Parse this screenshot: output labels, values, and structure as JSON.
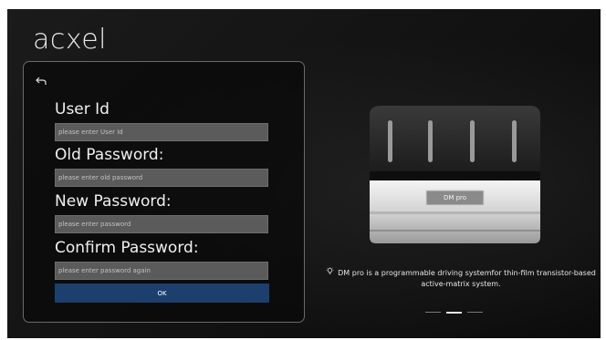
{
  "brand": {
    "name": "acxel"
  },
  "form": {
    "back_icon": "back-arrow-icon",
    "user_id_label": "User Id",
    "user_id_placeholder": "please enter User Id",
    "old_password_label": "Old Password:",
    "old_password_placeholder": "please enter old password",
    "new_password_label": "New Password:",
    "new_password_placeholder": "please enter password",
    "confirm_password_label": "Confirm Password:",
    "confirm_password_placeholder": "please enter password again",
    "ok_label": "OK",
    "ok_color": "#1c3f6e"
  },
  "product": {
    "badge": "DM pro",
    "caption_icon": "lightbulb-icon",
    "caption": "DM pro is a programmable driving systemfor thin-film transistor-based active-matrix system.",
    "carousel_active_index": 1,
    "carousel_count": 3
  }
}
